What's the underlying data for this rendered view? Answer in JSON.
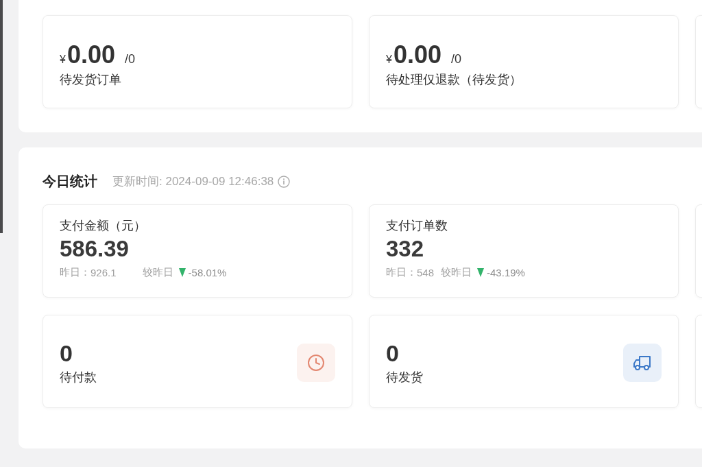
{
  "pending_section": {
    "cards": [
      {
        "currency": "¥",
        "amount": "0.00",
        "count": "/0",
        "label": "待发货订单"
      },
      {
        "currency": "¥",
        "amount": "0.00",
        "count": "/0",
        "label": "待处理仅退款（待发货）"
      }
    ]
  },
  "today_stats": {
    "title": "今日统计",
    "updated": "更新时间: 2024-09-09 12:46:38",
    "metrics": [
      {
        "label": "支付金额（元）",
        "value": "586.39",
        "yesterday_label": "昨日：",
        "yesterday": "926.1",
        "compare_label": "较昨日",
        "decline": true,
        "change": "-58.01%"
      },
      {
        "label": "支付订单数",
        "value": "332",
        "yesterday_label": "昨日：",
        "yesterday": "548",
        "compare_label": "较昨日",
        "decline": true,
        "change": "-43.19%"
      }
    ],
    "counters": [
      {
        "value": "0",
        "label": "待付款",
        "color": "#e3866f"
      },
      {
        "value": "0",
        "label": "待发货",
        "color": "#3b78c8"
      }
    ]
  }
}
